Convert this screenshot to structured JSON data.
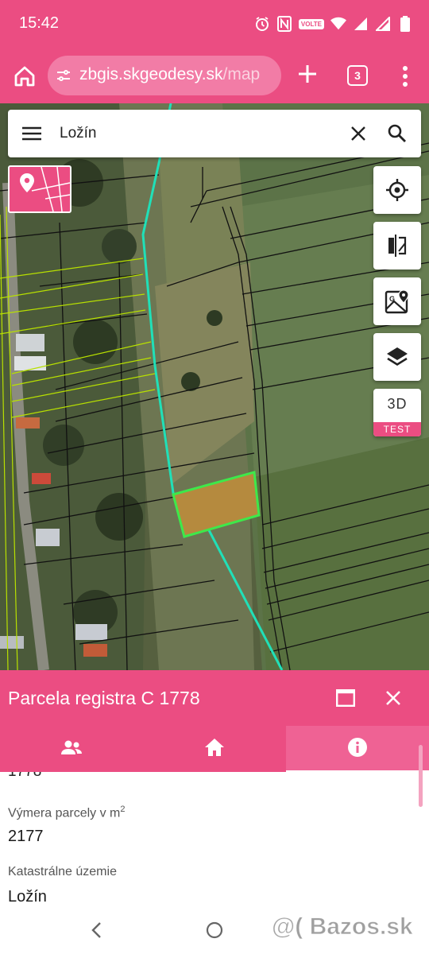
{
  "status_bar": {
    "time": "15:42",
    "volte_label": "VOLTE",
    "icons": [
      "alarm-icon",
      "nfc-icon",
      "volte-icon",
      "wifi-icon",
      "signal-icon",
      "signal-icon",
      "battery-icon"
    ]
  },
  "browser": {
    "url_main": "zbgis.skgeodesy.sk",
    "url_rest": "/map",
    "tab_count": "3",
    "icons": [
      "home-icon",
      "site-settings-icon",
      "new-tab-icon",
      "overflow-menu-icon"
    ]
  },
  "search": {
    "query": "Ložín",
    "icons": [
      "hamburger-menu-icon",
      "clear-icon",
      "search-icon"
    ]
  },
  "map_controls": {
    "three_d_label": "3D",
    "test_tag": "TEST",
    "icons": [
      "my-location-icon",
      "compare-icon",
      "map-layers-google-icon",
      "layers-icon"
    ]
  },
  "colors": {
    "brand": "#eb4d82",
    "parcel_outline": "#3ee84a",
    "boundary_line": "#20e0b8"
  },
  "panel": {
    "title": "Parcela registra C 1778",
    "tabs": [
      {
        "name": "owners",
        "icon": "people-icon"
      },
      {
        "name": "building",
        "icon": "home-icon"
      },
      {
        "name": "info",
        "icon": "info-icon",
        "active": true
      }
    ],
    "cut_off_value": "1778",
    "fields": [
      {
        "label": "Výmera parcely v m",
        "label_sup": "2",
        "value": "2177"
      },
      {
        "label": "Katastrálne územie",
        "value": "Ložín"
      }
    ]
  },
  "nav": {
    "watermark": "@( Bazos.sk",
    "icons": [
      "back-icon",
      "home-circle-icon"
    ]
  }
}
